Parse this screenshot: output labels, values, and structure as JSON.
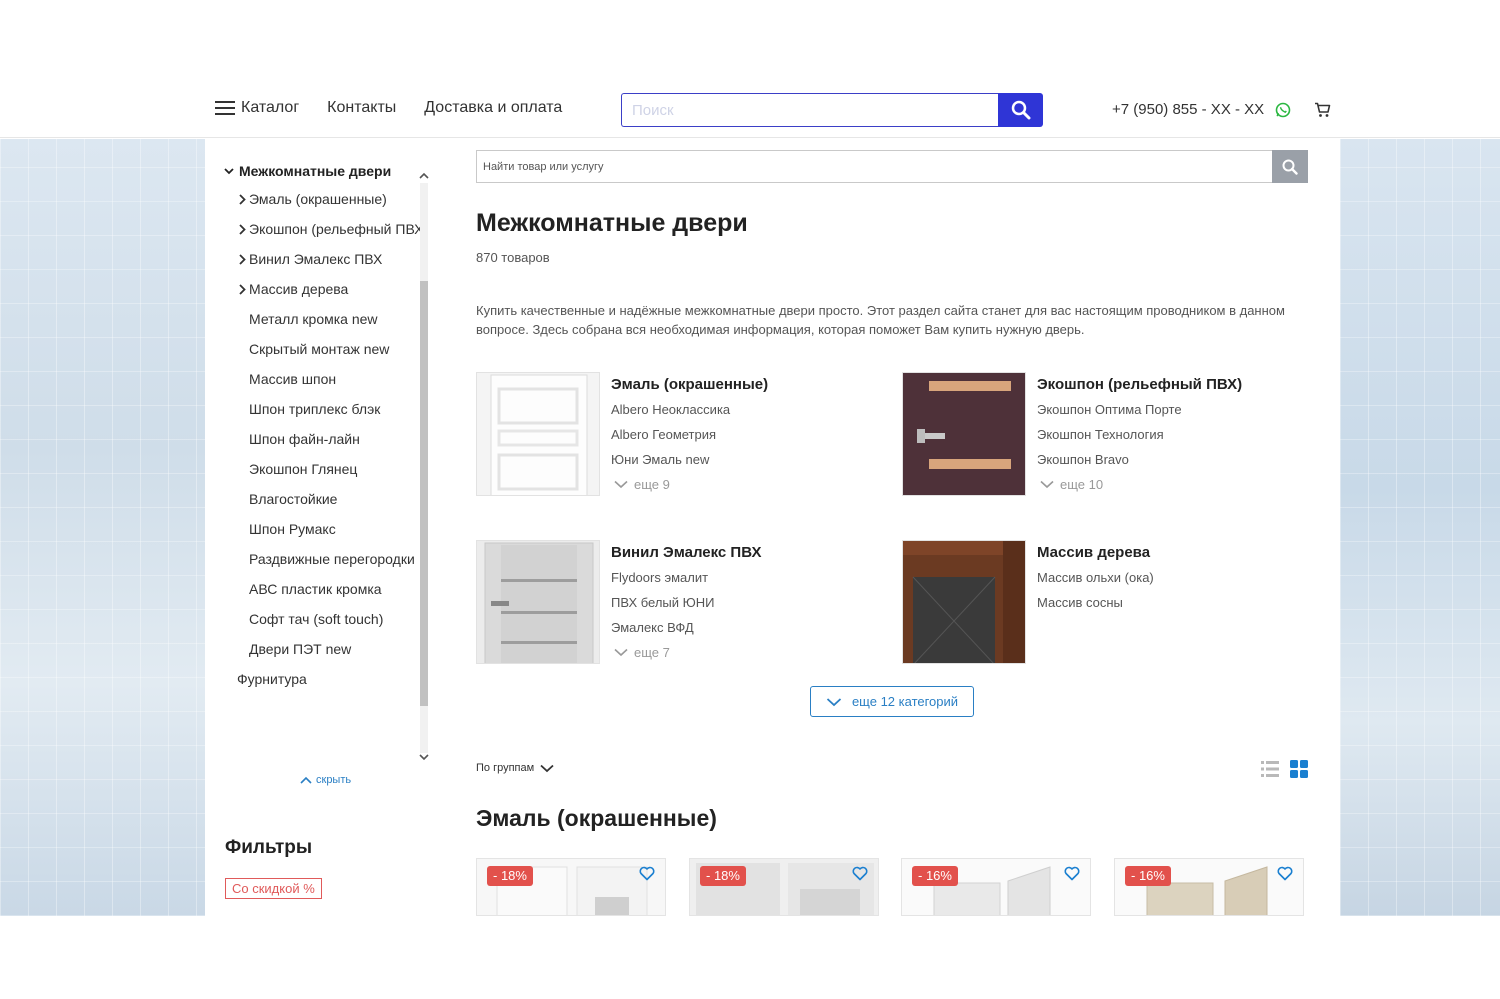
{
  "header": {
    "nav": [
      "Каталог",
      "Контакты",
      "Доставка и оплата"
    ],
    "search_placeholder": "Поиск",
    "phone": "+7 (950) 855 - XX - XX",
    "icons": [
      "menu-icon",
      "search-icon",
      "whatsapp-icon",
      "cart-icon"
    ]
  },
  "sidebar": {
    "section": "Межкомнатные двери",
    "items": [
      {
        "label": "Эмаль (окрашенные)",
        "arrow": true
      },
      {
        "label": "Экошпон (рельефный ПВХ)",
        "arrow": true
      },
      {
        "label": "Винил Эмалекс ПВХ",
        "arrow": true
      },
      {
        "label": "Массив дерева",
        "arrow": true
      },
      {
        "label": "Металл кромка new",
        "arrow": false
      },
      {
        "label": "Скрытый монтаж new",
        "arrow": false
      },
      {
        "label": "Массив шпон",
        "arrow": false
      },
      {
        "label": "Шпон триплекс блэк",
        "arrow": false
      },
      {
        "label": "Шпон файн-лайн",
        "arrow": false
      },
      {
        "label": "Экошпон Глянец",
        "arrow": false
      },
      {
        "label": "Влагостойкие",
        "arrow": false
      },
      {
        "label": "Шпон Румакс",
        "arrow": false
      },
      {
        "label": "Раздвижные перегородки",
        "arrow": false
      },
      {
        "label": "АВС пластик кромка",
        "arrow": false
      },
      {
        "label": "Софт тач (soft touch)",
        "arrow": false
      },
      {
        "label": "Двери ПЭТ new",
        "arrow": false
      }
    ],
    "root_item": "Фурнитура",
    "hide_label": "скрыть",
    "filters_title": "Фильтры",
    "discount_chip": "Со скидкой %"
  },
  "main": {
    "search_placeholder": "Найти товар или услугу",
    "title": "Межкомнатные двери",
    "count": "870 товаров",
    "description": "Купить качественные и надёжные межкомнатные двери просто. Этот раздел сайта станет для вас настоящим проводником в данном вопросе. Здесь собрана вся необходимая информация, которая поможет Вам купить нужную дверь.",
    "categories": [
      {
        "name": "Эмаль (окрашенные)",
        "subs": [
          "Albero Неоклассика",
          "Albero Геометрия",
          "Юни Эмаль new"
        ],
        "more": "еще 9"
      },
      {
        "name": "Экошпон (рельефный ПВХ)",
        "subs": [
          "Экошпон Оптима Порте",
          "Экошпон Технология",
          "Экошпон Bravo"
        ],
        "more": "еще 10"
      },
      {
        "name": "Винил Эмалекс ПВХ",
        "subs": [
          "Flydoors эмалит",
          "ПВХ белый ЮНИ",
          "Эмалекс ВФД"
        ],
        "more": "еще 7"
      },
      {
        "name": "Массив дерева",
        "subs": [
          "Массив ольхи (ока)",
          "Массив сосны"
        ],
        "more": ""
      }
    ],
    "more_categories": "еще 12 категорий",
    "group_by": "По группам",
    "section_title": "Эмаль (окрашенные)",
    "products": [
      {
        "discount": "- 18%"
      },
      {
        "discount": "- 18%"
      },
      {
        "discount": "- 16%"
      },
      {
        "discount": "- 16%"
      }
    ]
  },
  "colors": {
    "accent": "#2f35d6",
    "link": "#2a7fc4",
    "sale": "#e2514c"
  }
}
